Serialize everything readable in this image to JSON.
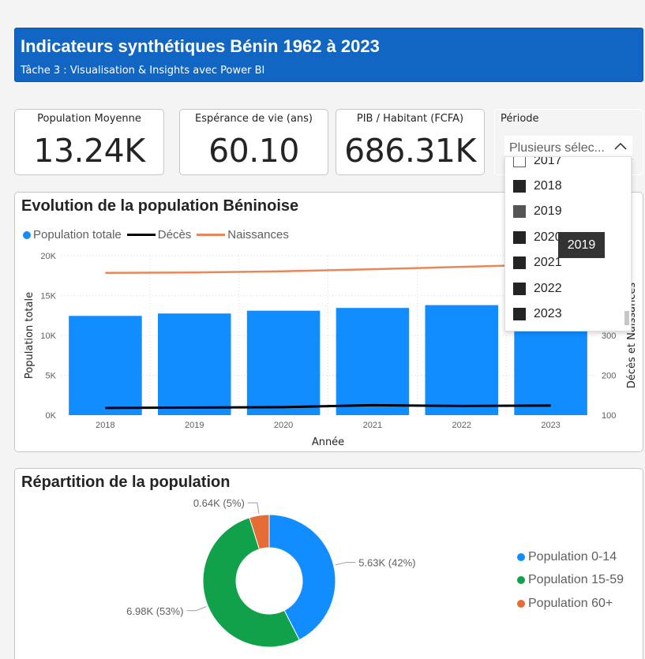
{
  "header": {
    "title": "Indicateurs synthétiques Bénin 1962 à 2023",
    "subtitle": "Tâche 3 : Visualisation & Insights avec Power BI"
  },
  "kpis": [
    {
      "label": "Population Moyenne",
      "value": "13.24K"
    },
    {
      "label": "Espérance de vie (ans)",
      "value": "60.10"
    },
    {
      "label": "PIB / Habitant (FCFA)",
      "value": "686.31K"
    }
  ],
  "periode": {
    "label": "Période",
    "selected_text": "Plusieurs sélec...",
    "items": [
      {
        "label": "2017",
        "state": "off"
      },
      {
        "label": "2018",
        "state": "on"
      },
      {
        "label": "2019",
        "state": "partial"
      },
      {
        "label": "2020",
        "state": "on"
      },
      {
        "label": "2021",
        "state": "on"
      },
      {
        "label": "2022",
        "state": "on"
      },
      {
        "label": "2023",
        "state": "on"
      }
    ],
    "tooltip": "2019"
  },
  "colors": {
    "banner": "#1166c4",
    "population": "#118dff",
    "deces": "#000000",
    "naissances": "#e8875a",
    "age_0_14": "#118dff",
    "age_15_59": "#12a14b",
    "age_60_plus": "#e66c37"
  },
  "chart_data": [
    {
      "type": "bar",
      "title": "Evolution de la population Béninoise",
      "xlabel": "Année",
      "ylabel": "Population totale",
      "y2label": "Décès et Naissances",
      "categories": [
        "2018",
        "2019",
        "2020",
        "2021",
        "2022",
        "2023"
      ],
      "ylim": [
        0,
        20000
      ],
      "yticks": [
        "0K",
        "5K",
        "10K",
        "15K",
        "20K"
      ],
      "y2lim": [
        100,
        500
      ],
      "y2ticks": [
        "100",
        "200",
        "300"
      ],
      "legend": [
        "Population totale",
        "Décès",
        "Naissances"
      ],
      "legend_position": "top-left",
      "grid": true,
      "series": [
        {
          "name": "Population totale",
          "type": "bar",
          "values": [
            12450,
            12750,
            13100,
            13450,
            13800,
            14100
          ]
        },
        {
          "name": "Décès",
          "type": "line",
          "axis": "secondary",
          "values": [
            118,
            119,
            120,
            125,
            123,
            124
          ]
        },
        {
          "name": "Naissances",
          "type": "line",
          "axis": "secondary",
          "values": [
            457,
            458,
            461,
            466,
            472,
            478
          ]
        }
      ]
    },
    {
      "type": "pie",
      "title": "Répartition de la population",
      "categories": [
        "Population 0-14",
        "Population 15-59",
        "Population 60+"
      ],
      "values": [
        5.63,
        6.98,
        0.64
      ],
      "labels": [
        "5.63K (42%)",
        "6.98K (53%)",
        "0.64K (5%)"
      ],
      "legend_position": "right"
    }
  ]
}
